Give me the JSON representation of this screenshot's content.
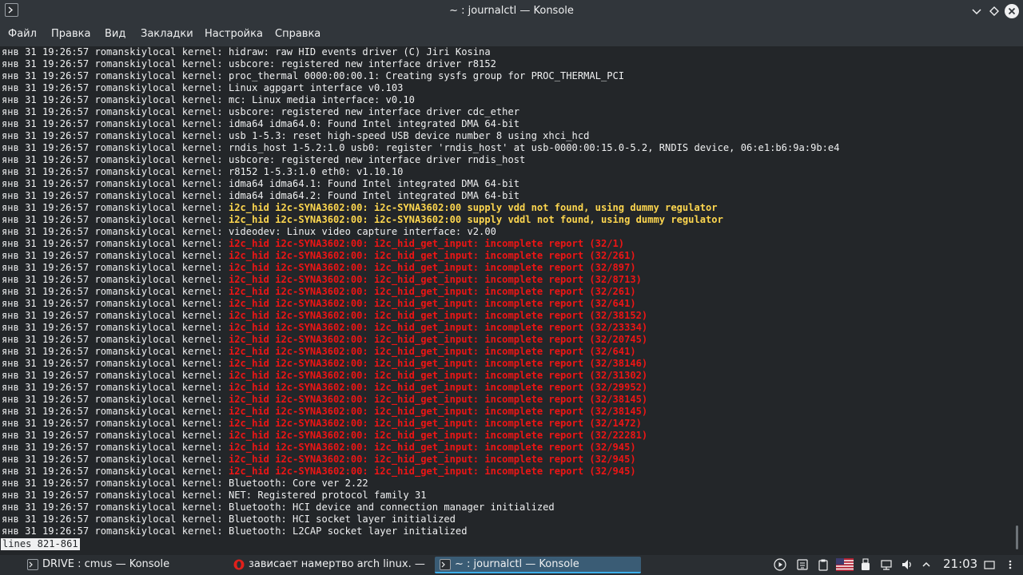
{
  "window": {
    "title": "~ : journalctl — Konsole"
  },
  "menu": [
    "Файл",
    "Правка",
    "Вид",
    "Закладки",
    "Настройка",
    "Справка"
  ],
  "log_prefix": "янв 31 19:26:57 romanskiylocal kernel: ",
  "log": [
    {
      "msg": "hidraw: raw HID events driver (C) Jiri Kosina",
      "level": "normal"
    },
    {
      "msg": "usbcore: registered new interface driver r8152",
      "level": "normal"
    },
    {
      "msg": "proc_thermal 0000:00:00.1: Creating sysfs group for PROC_THERMAL_PCI",
      "level": "normal"
    },
    {
      "msg": "Linux agpgart interface v0.103",
      "level": "normal"
    },
    {
      "msg": "mc: Linux media interface: v0.10",
      "level": "normal"
    },
    {
      "msg": "usbcore: registered new interface driver cdc_ether",
      "level": "normal"
    },
    {
      "msg": "idma64 idma64.0: Found Intel integrated DMA 64-bit",
      "level": "normal"
    },
    {
      "msg": "usb 1-5.3: reset high-speed USB device number 8 using xhci_hcd",
      "level": "normal"
    },
    {
      "msg": "rndis_host 1-5.2:1.0 usb0: register 'rndis_host' at usb-0000:00:15.0-5.2, RNDIS device, 06:e1:b6:9a:9b:e4",
      "level": "normal"
    },
    {
      "msg": "usbcore: registered new interface driver rndis_host",
      "level": "normal"
    },
    {
      "msg": "r8152 1-5.3:1.0 eth0: v1.10.10",
      "level": "normal"
    },
    {
      "msg": "idma64 idma64.1: Found Intel integrated DMA 64-bit",
      "level": "normal"
    },
    {
      "msg": "idma64 idma64.2: Found Intel integrated DMA 64-bit",
      "level": "normal"
    },
    {
      "msg": "i2c_hid i2c-SYNA3602:00: i2c-SYNA3602:00 supply vdd not found, using dummy regulator",
      "level": "warn"
    },
    {
      "msg": "i2c_hid i2c-SYNA3602:00: i2c-SYNA3602:00 supply vddl not found, using dummy regulator",
      "level": "warn"
    },
    {
      "msg": "videodev: Linux video capture interface: v2.00",
      "level": "normal"
    },
    {
      "msg": "i2c_hid i2c-SYNA3602:00: i2c_hid_get_input: incomplete report (32/1)",
      "level": "err"
    },
    {
      "msg": "i2c_hid i2c-SYNA3602:00: i2c_hid_get_input: incomplete report (32/261)",
      "level": "err"
    },
    {
      "msg": "i2c_hid i2c-SYNA3602:00: i2c_hid_get_input: incomplete report (32/897)",
      "level": "err"
    },
    {
      "msg": "i2c_hid i2c-SYNA3602:00: i2c_hid_get_input: incomplete report (32/8713)",
      "level": "err"
    },
    {
      "msg": "i2c_hid i2c-SYNA3602:00: i2c_hid_get_input: incomplete report (32/261)",
      "level": "err"
    },
    {
      "msg": "i2c_hid i2c-SYNA3602:00: i2c_hid_get_input: incomplete report (32/641)",
      "level": "err"
    },
    {
      "msg": "i2c_hid i2c-SYNA3602:00: i2c_hid_get_input: incomplete report (32/38152)",
      "level": "err"
    },
    {
      "msg": "i2c_hid i2c-SYNA3602:00: i2c_hid_get_input: incomplete report (32/23334)",
      "level": "err"
    },
    {
      "msg": "i2c_hid i2c-SYNA3602:00: i2c_hid_get_input: incomplete report (32/20745)",
      "level": "err"
    },
    {
      "msg": "i2c_hid i2c-SYNA3602:00: i2c_hid_get_input: incomplete report (32/641)",
      "level": "err"
    },
    {
      "msg": "i2c_hid i2c-SYNA3602:00: i2c_hid_get_input: incomplete report (32/38146)",
      "level": "err"
    },
    {
      "msg": "i2c_hid i2c-SYNA3602:00: i2c_hid_get_input: incomplete report (32/31302)",
      "level": "err"
    },
    {
      "msg": "i2c_hid i2c-SYNA3602:00: i2c_hid_get_input: incomplete report (32/29952)",
      "level": "err"
    },
    {
      "msg": "i2c_hid i2c-SYNA3602:00: i2c_hid_get_input: incomplete report (32/38145)",
      "level": "err"
    },
    {
      "msg": "i2c_hid i2c-SYNA3602:00: i2c_hid_get_input: incomplete report (32/38145)",
      "level": "err"
    },
    {
      "msg": "i2c_hid i2c-SYNA3602:00: i2c_hid_get_input: incomplete report (32/1472)",
      "level": "err"
    },
    {
      "msg": "i2c_hid i2c-SYNA3602:00: i2c_hid_get_input: incomplete report (32/22281)",
      "level": "err"
    },
    {
      "msg": "i2c_hid i2c-SYNA3602:00: i2c_hid_get_input: incomplete report (32/945)",
      "level": "err"
    },
    {
      "msg": "i2c_hid i2c-SYNA3602:00: i2c_hid_get_input: incomplete report (32/945)",
      "level": "err"
    },
    {
      "msg": "i2c_hid i2c-SYNA3602:00: i2c_hid_get_input: incomplete report (32/945)",
      "level": "err"
    },
    {
      "msg": "Bluetooth: Core ver 2.22",
      "level": "normal"
    },
    {
      "msg": "NET: Registered protocol family 31",
      "level": "normal"
    },
    {
      "msg": "Bluetooth: HCI device and connection manager initialized",
      "level": "normal"
    },
    {
      "msg": "Bluetooth: HCI socket layer initialized",
      "level": "normal"
    },
    {
      "msg": "Bluetooth: L2CAP socket layer initialized",
      "level": "normal"
    }
  ],
  "pager_status": "lines 821-861",
  "taskbar": {
    "tasks": [
      {
        "label": "DRIVE : cmus — Konsole",
        "icon": "terminal-icon",
        "active": false
      },
      {
        "label": "зависает намертво arch linux. — ...",
        "icon": "opera-icon",
        "active": false
      },
      {
        "label": "~ : journalctl — Konsole",
        "icon": "terminal-icon",
        "active": true
      }
    ],
    "clock": "21:03"
  },
  "colors": {
    "accent": "#3daee9",
    "warn": "#fdd64f",
    "error": "#ed1515",
    "background": "#232629"
  }
}
